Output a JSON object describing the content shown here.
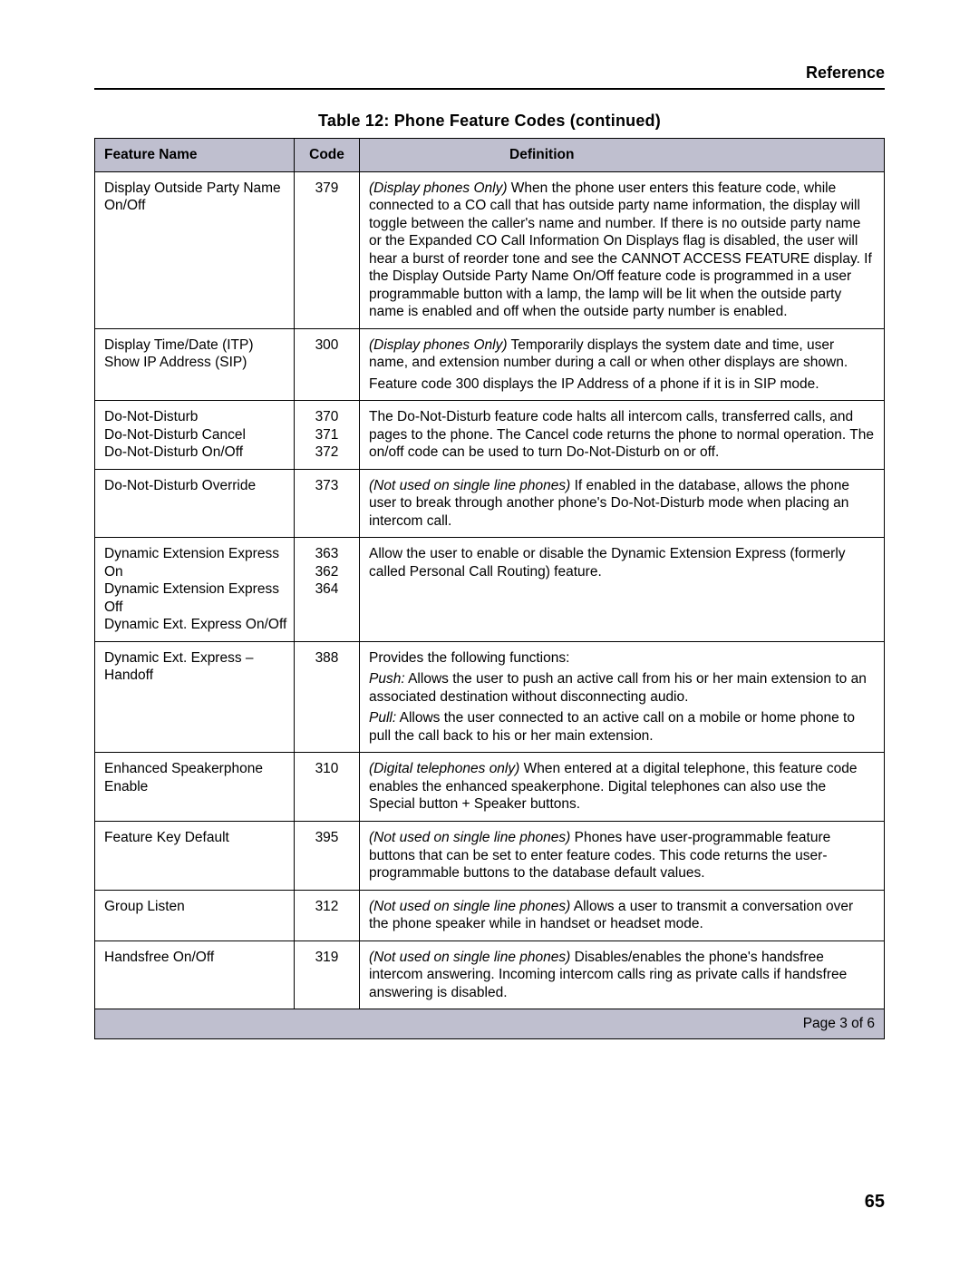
{
  "header": "Reference",
  "caption": "Table 12:   Phone Feature Codes (continued)",
  "columns": {
    "name": "Feature Name",
    "code": "Code",
    "def": "Definition"
  },
  "rows": [
    {
      "name": "Display Outside Party Name\nOn/Off",
      "code": "379",
      "def": "<span class=\"i\">(Display phones Only)</span> When the phone user enters this feature code, while connected to a CO call that has outside party name information, the display will toggle between the caller's name and number. If there is no outside party name or the Expanded CO Call Information On Displays flag is disabled, the user will hear a burst of reorder tone and see the CANNOT ACCESS FEATURE display. If the Display Outside Party Name On/Off feature code is programmed in a user programmable button with a lamp, the lamp will be lit when the outside party name is enabled and off when the outside party number is enabled."
    },
    {
      "name": "Display Time/Date (ITP)\nShow IP Address (SIP)",
      "code": "300",
      "def": "<p><span class=\"i\">(Display phones Only)</span> Temporarily displays the system date and time, user name, and extension number during a call or when other displays are shown.</p><p>Feature code 300 displays the IP Address of a phone if it is in SIP mode.</p>"
    },
    {
      "name": "Do-Not-Disturb\nDo-Not-Disturb Cancel\nDo-Not-Disturb On/Off",
      "code": "370\n371\n372",
      "def": "The Do-Not-Disturb feature code halts all intercom calls, transferred calls, and pages to the phone. The Cancel code returns the phone to normal operation. The on/off code can be used to turn Do-Not-Disturb on or off."
    },
    {
      "name": "Do-Not-Disturb Override",
      "code": "373",
      "def": "<span class=\"i\">(Not used on single line phones)</span> If enabled in the database, allows the phone user to break through another phone's Do-Not-Disturb mode when placing an intercom call."
    },
    {
      "name": "Dynamic Extension Express On\nDynamic Extension Express Off\nDynamic Ext. Express On/Off",
      "code": "363\n362\n364",
      "def": "Allow the user to enable or disable the Dynamic Extension Express (formerly called Personal Call Routing) feature."
    },
    {
      "name": "Dynamic Ext. Express – Handoff",
      "code": "388",
      "def": "<p>Provides the following functions:</p><p><span class=\"i\">Push:</span> Allows the user to push an active call from his or her main extension to an associated destination without disconnecting audio.</p><p><span class=\"i\">Pull:</span> Allows the user connected to an active call on a mobile or home phone to pull the call back to his or her main extension.</p>"
    },
    {
      "name": "Enhanced Speakerphone Enable",
      "code": "310",
      "def": "<span class=\"i\">(Digital telephones only)</span> When entered at a digital telephone, this feature code enables the enhanced speakerphone. Digital telephones can also use the Special button + Speaker buttons."
    },
    {
      "name": "Feature Key Default",
      "code": "395",
      "def": "<span class=\"i\">(Not used on single line phones)</span> Phones have user-programmable feature buttons that can be set to enter feature codes. This code returns the user-programmable buttons to the database default values."
    },
    {
      "name": "Group Listen",
      "code": "312",
      "def": "<span class=\"i\">(Not used on single line phones)</span> Allows a user to transmit a conversation over the phone speaker while in handset or headset mode."
    },
    {
      "name": "Handsfree On/Off",
      "code": "319",
      "def": "<span class=\"i\">(Not used on single line phones)</span> Disables/enables the phone's handsfree intercom answering. Incoming intercom calls ring as private calls if handsfree answering is disabled."
    }
  ],
  "pager": "Page 3 of 6",
  "pageNumber": "65"
}
